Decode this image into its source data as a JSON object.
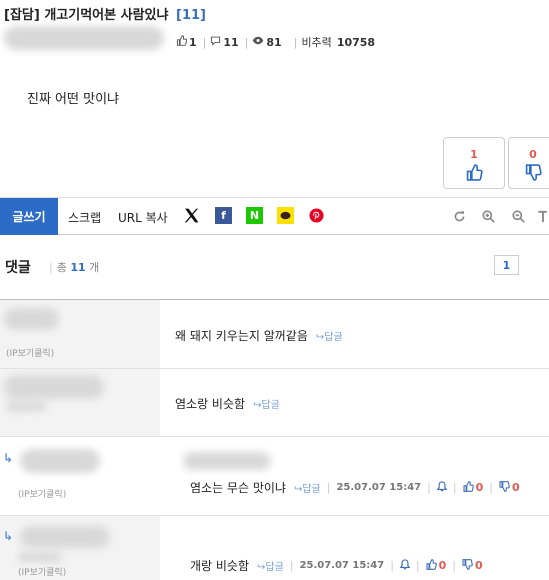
{
  "post": {
    "category": "[잡담]",
    "title": "개고기먹어본 사람있냐",
    "comment_count": "[11]",
    "likes": "1",
    "comments": "11",
    "views": "81",
    "ratio_label": "비추력",
    "ratio_value": "10758",
    "body": "진짜 어떤 맛이냐"
  },
  "votes": {
    "up_count": "1",
    "down_count": "0"
  },
  "toolbar": {
    "write_label": "글쓰기",
    "scrap_label": "스크랩",
    "url_copy_label": "URL 복사",
    "social": {
      "x_icon": "X",
      "facebook_icon": "f",
      "naver_icon": "N",
      "kakao_icon": "kakao",
      "pinterest_icon": "P"
    }
  },
  "comments_section": {
    "title": "댓글",
    "total_prefix": "총",
    "total_count": "11",
    "total_suffix": "개",
    "page": "1"
  },
  "comments": [
    {
      "ip_label": "(IP보기클릭)",
      "text": "왜 돼지 키우는지 알꺼같음",
      "reply_label": "답글"
    },
    {
      "ip_label": "",
      "text": "염소랑 비슷함",
      "reply_label": "답글"
    },
    {
      "ip_label": "(IP보기클릭)",
      "text": "염소는 무슨 맛이냐",
      "reply_label": "답글",
      "date": "25.07.07 15:47",
      "up": "0",
      "down": "0"
    },
    {
      "ip_label": "(IP보기클릭)",
      "text": "개랑 비슷함",
      "reply_label": "답글",
      "date": "25.07.07 15:47",
      "up": "0",
      "down": "0"
    }
  ],
  "colors": {
    "accent": "#2c6cc7",
    "downvote": "#e05a4f"
  }
}
